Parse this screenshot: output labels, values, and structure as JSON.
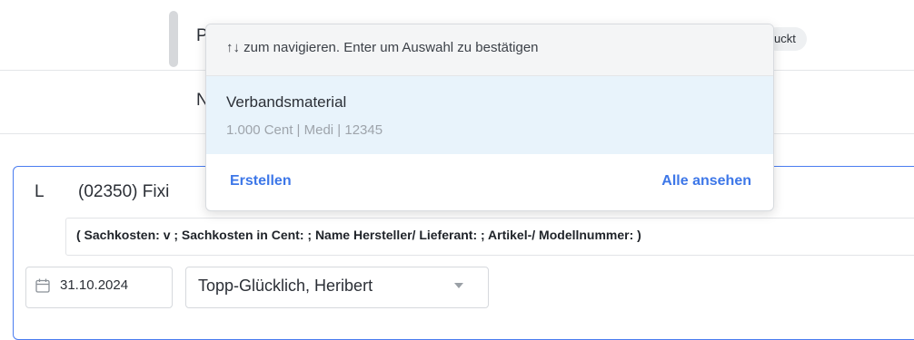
{
  "background": {
    "row1_letter": "P",
    "row1_badge": "uckt",
    "row2_letter": "N"
  },
  "entry": {
    "letter": "L",
    "code_title": "(02350) Fixi",
    "details": "( Sachkosten: v ; Sachkosten in Cent: ; Name Hersteller/ Lieferant: ; Artikel-/ Modellnummer: )",
    "date": "31.10.2024",
    "date_icon": "calendar-icon",
    "person": "Topp-Glücklich, Heribert",
    "person_icon": "chevron-down-icon"
  },
  "dropdown": {
    "hint": "↑↓ zum navigieren. Enter um Auswahl zu bestätigen",
    "items": [
      {
        "name": "Verbandsmaterial",
        "meta": "1.000 Cent | Medi | 12345"
      }
    ],
    "create_label": "Erstellen",
    "view_all_label": "Alle ansehen"
  },
  "colors": {
    "accent": "#3d77e8",
    "card_border": "#4a7cf0",
    "highlight": "#e8f3fb"
  }
}
